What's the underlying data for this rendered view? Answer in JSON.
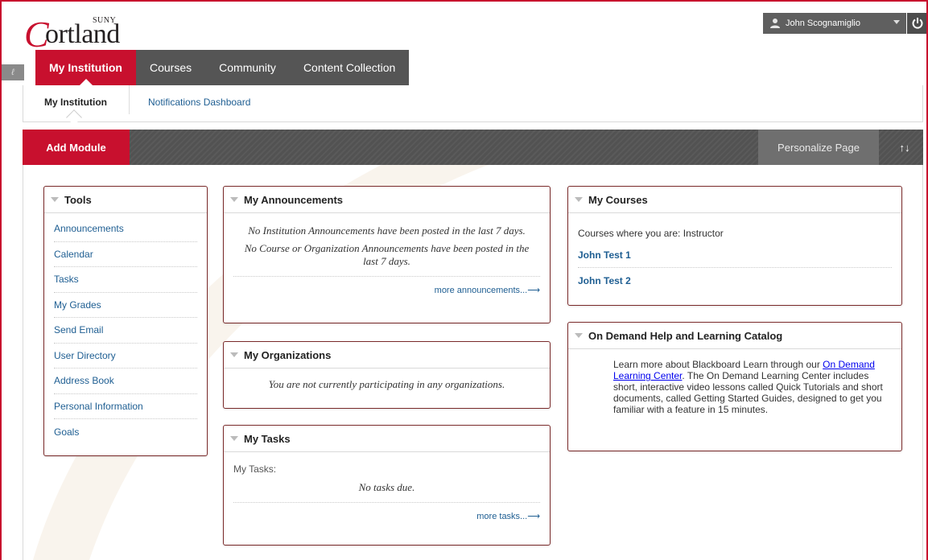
{
  "brand": {
    "logo_main": "ortland",
    "logo_c": "C",
    "logo_suny": "SUNY"
  },
  "user": {
    "name": "John Scognamiglio"
  },
  "tabs": [
    {
      "label": "My Institution",
      "active": true
    },
    {
      "label": "Courses",
      "active": false
    },
    {
      "label": "Community",
      "active": false
    },
    {
      "label": "Content Collection",
      "active": false
    }
  ],
  "subnav": {
    "active": "My Institution",
    "link": "Notifications Dashboard"
  },
  "toolbar": {
    "add_module": "Add Module",
    "personalize": "Personalize Page",
    "reorder": "↑↓"
  },
  "tools": {
    "title": "Tools",
    "items": [
      "Announcements",
      "Calendar",
      "Tasks",
      "My Grades",
      "Send Email",
      "User Directory",
      "Address Book",
      "Personal Information",
      "Goals"
    ]
  },
  "announcements": {
    "title": "My Announcements",
    "line1": "No Institution Announcements have been posted in the last 7 days.",
    "line2": "No Course or Organization Announcements have been posted in the last 7 days.",
    "more": "more announcements...⟶"
  },
  "organizations": {
    "title": "My Organizations",
    "message": "You are not currently participating in any organizations."
  },
  "tasks": {
    "title": "My Tasks",
    "label": "My Tasks:",
    "message": "No tasks due.",
    "more": "more tasks...⟶"
  },
  "courses": {
    "title": "My Courses",
    "role_line": "Courses where you are: Instructor",
    "items": [
      "John Test 1",
      "John Test 2"
    ]
  },
  "ondemand": {
    "title": "On Demand Help and Learning Catalog",
    "text_before": "Learn more about Blackboard Learn through our ",
    "link": "On Demand Learning Center",
    "text_after": ". The On Demand Learning Center includes short, interactive video lessons called Quick Tutorials and short documents, called Getting Started Guides, designed to get you familiar with a feature in 15 minutes."
  },
  "colors": {
    "accent": "#c8102e",
    "link": "#1e5e92",
    "tab_bg": "#555555",
    "module_border": "#7a2a2a"
  },
  "icons": {
    "user": "person-icon",
    "power": "power-icon",
    "dropdown": "chevron-down-icon"
  }
}
